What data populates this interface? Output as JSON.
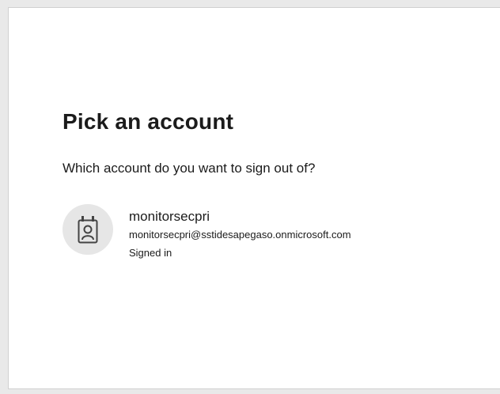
{
  "dialog": {
    "title": "Pick an account",
    "subtitle": "Which account do you want to sign out of?"
  },
  "accounts": [
    {
      "name": "monitorsecpri",
      "email": "monitorsecpri@sstidesapegaso.onmicrosoft.com",
      "status": "Signed in",
      "icon": "work-account-badge-icon"
    }
  ]
}
